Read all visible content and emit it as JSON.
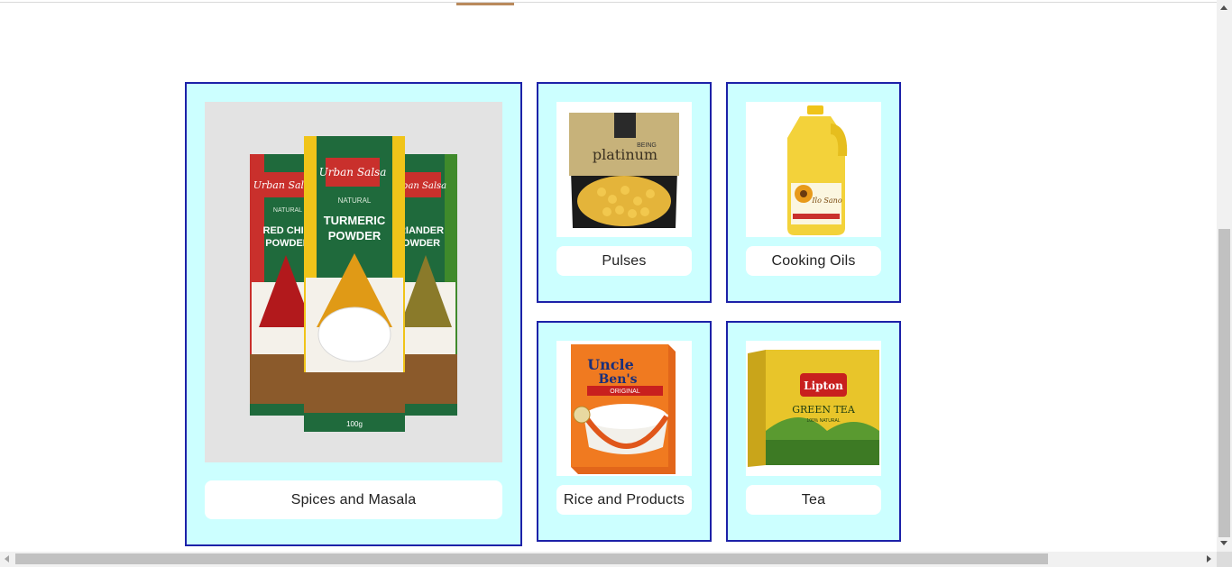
{
  "categories": [
    {
      "label": "Spices and Masala",
      "image_icon": "spice-packets-image"
    },
    {
      "label": "Pulses",
      "image_icon": "pulses-bag-image"
    },
    {
      "label": "Cooking Oils",
      "image_icon": "oil-bottle-image"
    },
    {
      "label": "Rice and Products",
      "image_icon": "rice-box-image"
    },
    {
      "label": "Tea",
      "image_icon": "tea-box-image"
    }
  ],
  "packaging_text": {
    "spices": {
      "brand": "Urban Salsa",
      "natural": "NATURAL",
      "left_product": [
        "RED CHILI",
        "POWDER"
      ],
      "center_product": [
        "TURMERIC",
        "POWDER"
      ],
      "right_product": [
        "RIANDER",
        "OWDER"
      ],
      "weight": "100g"
    },
    "pulses": {
      "line1": "BEING",
      "line2": "platinum"
    },
    "oils": {
      "brand": "Ilo Sano"
    },
    "rice": {
      "brand_line1": "Uncle",
      "brand_line2": "Ben's",
      "variety": "ORIGINAL"
    },
    "tea": {
      "brand": "Lipton",
      "product": "GREEN TEA",
      "sub": "100% NATURAL"
    }
  },
  "colors": {
    "card_bg": "#ccffff",
    "card_border": "#1c21a8",
    "accent_underline": "#b98a5c"
  }
}
